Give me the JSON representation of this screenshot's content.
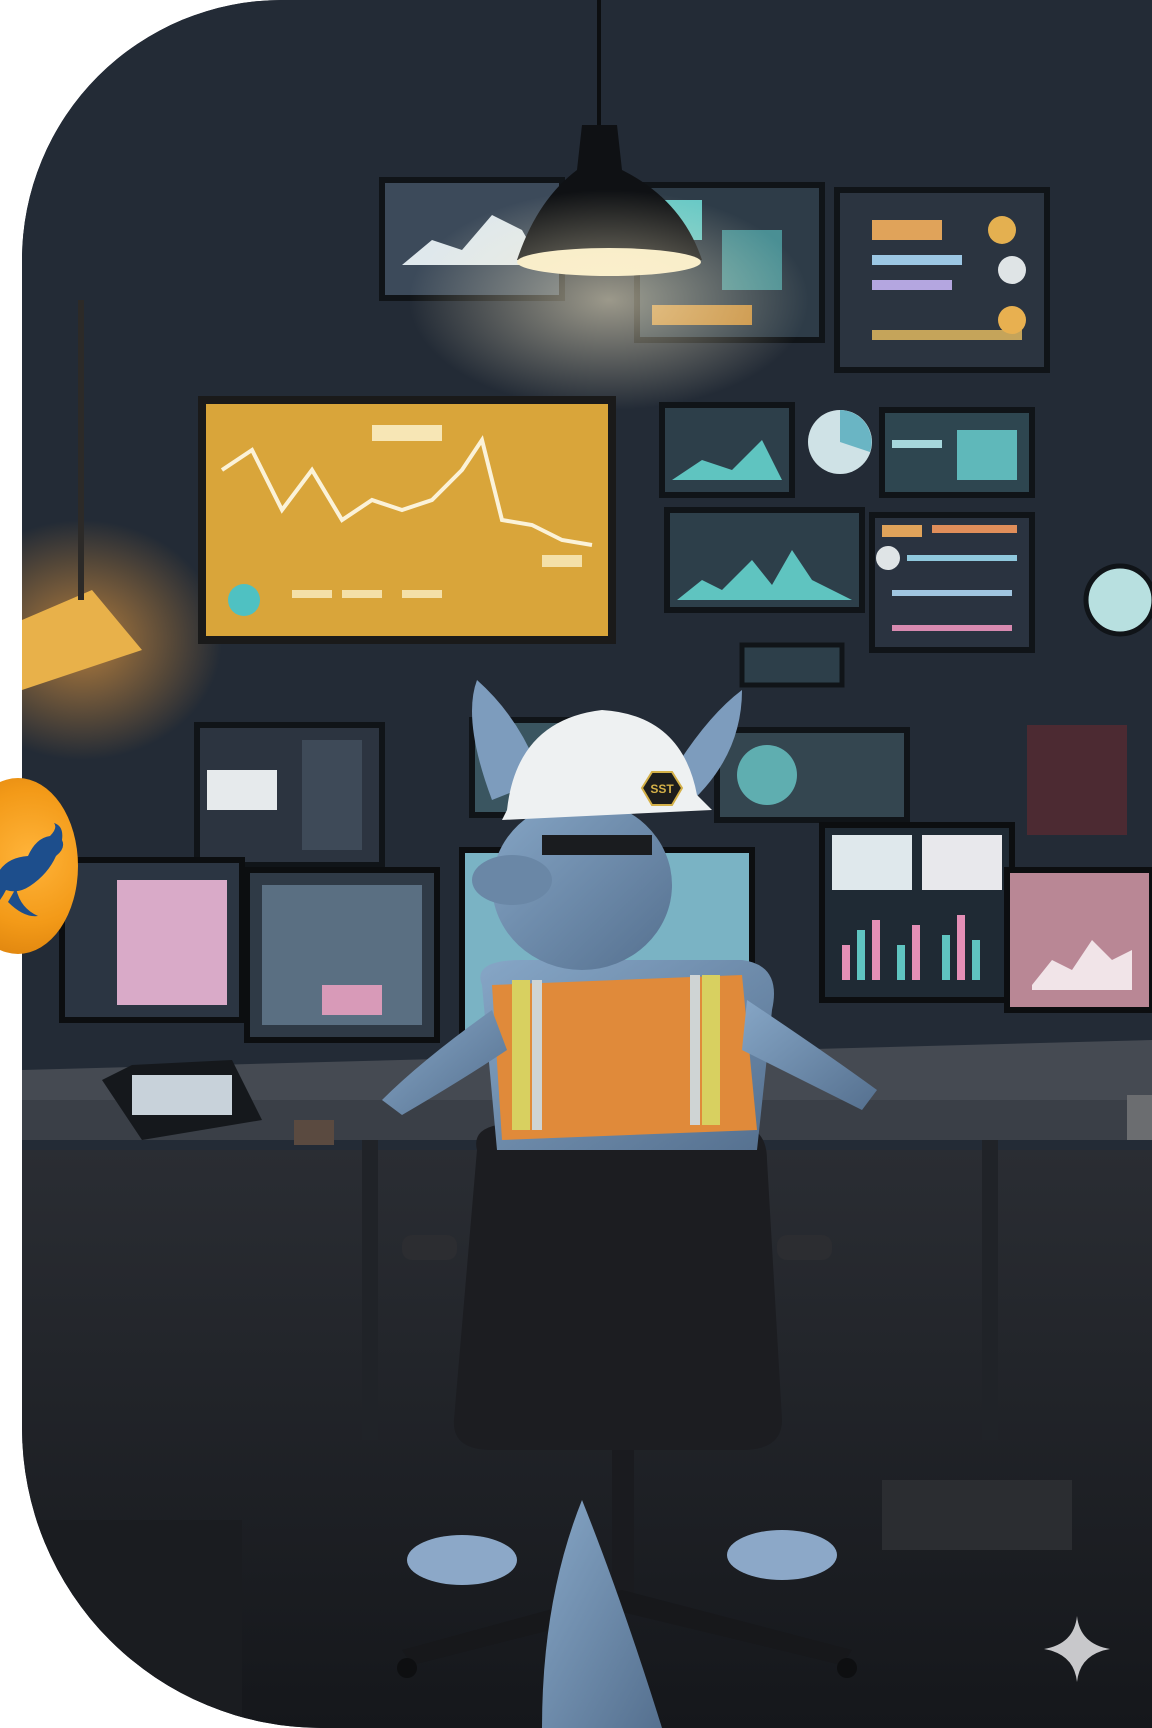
{
  "scene": {
    "subject": "kangaroo-mascot",
    "helmet_logo_text": "SST",
    "colors": {
      "wall": "#232b36",
      "desk": "#3a3f47",
      "fur": "#6f8fb0",
      "vest": "#e08a3a",
      "vest_stripe": "#d8d060",
      "chart_yellow": "#d9a53a",
      "screen_teal": "#5fc4c0",
      "screen_pink": "#d99ab5",
      "lamp_glow": "#f4e7c2"
    }
  },
  "badge": {
    "icon": "kangaroo-icon",
    "color": "#f39a18"
  },
  "sparkle": {
    "icon": "sparkle-icon"
  }
}
